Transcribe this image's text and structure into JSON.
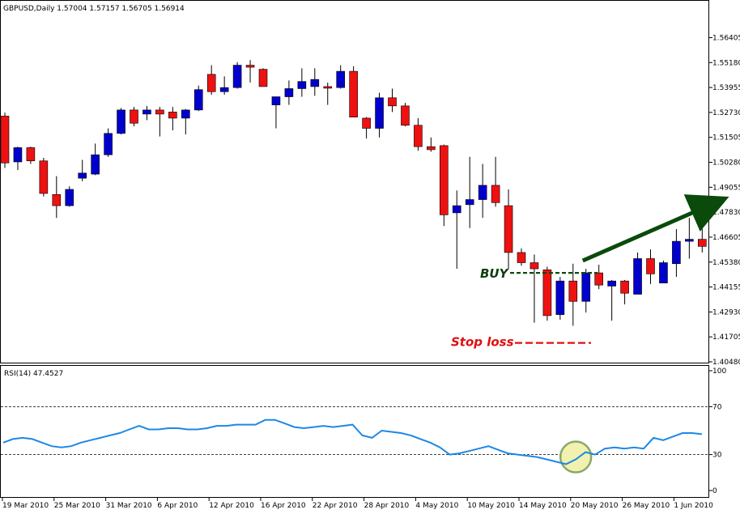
{
  "main_header": "GBPUSD,Daily  1.57004 1.57157 1.56705 1.56914",
  "rsi_header": "RSI(14) 47.4527",
  "chart_data": [
    {
      "type": "candlestick",
      "symbol": "GBPUSD",
      "timeframe": "Daily",
      "ohlc_readout": [
        1.57004,
        1.57157,
        1.56705,
        1.56914
      ],
      "y_ticks": [
        "1.56405",
        "1.55180",
        "1.53955",
        "1.52730",
        "1.51505",
        "1.50280",
        "1.49055",
        "1.47830",
        "1.46605",
        "1.45380",
        "1.44155",
        "1.42930",
        "1.41705",
        "1.40480"
      ],
      "ylim": [
        1.4048,
        1.5702
      ],
      "x_ticks": [
        "19 Mar 2010",
        "25 Mar 2010",
        "31 Mar 2010",
        "6 Apr 2010",
        "12 Apr 2010",
        "16 Apr 2010",
        "22 Apr 2010",
        "28 Apr 2010",
        "4 May 2010",
        "10 May 2010",
        "14 May 2010",
        "20 May 2010",
        "26 May 2010",
        "1 Jun 2010"
      ],
      "x_tick_index": [
        0,
        4,
        8,
        12,
        16,
        20,
        24,
        28,
        32,
        36,
        40,
        44,
        48,
        52
      ],
      "bull_color": "#0000cc",
      "bear_color": "#ee1111",
      "candles": [
        [
          1.5255,
          1.5272,
          1.5,
          1.5025
        ],
        [
          1.503,
          1.5105,
          1.499,
          1.51
        ],
        [
          1.51,
          1.5105,
          1.502,
          1.5035
        ],
        [
          1.5035,
          1.505,
          1.486,
          1.4875
        ],
        [
          1.487,
          1.496,
          1.4755,
          1.4815
        ],
        [
          1.4815,
          1.491,
          1.481,
          1.4895
        ],
        [
          1.495,
          1.504,
          1.4935,
          1.4975
        ],
        [
          1.497,
          1.512,
          1.4965,
          1.5065
        ],
        [
          1.5065,
          1.5195,
          1.5055,
          1.517
        ],
        [
          1.517,
          1.5295,
          1.5165,
          1.5285
        ],
        [
          1.5285,
          1.53,
          1.5205,
          1.522
        ],
        [
          1.5265,
          1.5305,
          1.5235,
          1.5285
        ],
        [
          1.5285,
          1.53,
          1.5155,
          1.5265
        ],
        [
          1.5275,
          1.53,
          1.5185,
          1.5245
        ],
        [
          1.5245,
          1.529,
          1.5165,
          1.5285
        ],
        [
          1.5285,
          1.5405,
          1.528,
          1.5385
        ],
        [
          1.546,
          1.5505,
          1.536,
          1.5375
        ],
        [
          1.5375,
          1.545,
          1.536,
          1.5395
        ],
        [
          1.5395,
          1.552,
          1.539,
          1.5505
        ],
        [
          1.5505,
          1.553,
          1.542,
          1.5495
        ],
        [
          1.5485,
          1.549,
          1.54,
          1.54
        ],
        [
          1.531,
          1.535,
          1.5195,
          1.535
        ],
        [
          1.535,
          1.543,
          1.531,
          1.539
        ],
        [
          1.539,
          1.549,
          1.535,
          1.5425
        ],
        [
          1.54,
          1.549,
          1.5355,
          1.5435
        ],
        [
          1.54,
          1.542,
          1.531,
          1.5395
        ],
        [
          1.5395,
          1.5505,
          1.539,
          1.5475
        ],
        [
          1.5475,
          1.55,
          1.525,
          1.525
        ],
        [
          1.5245,
          1.525,
          1.5145,
          1.5195
        ],
        [
          1.5195,
          1.537,
          1.515,
          1.5345
        ],
        [
          1.5345,
          1.539,
          1.5275,
          1.5305
        ],
        [
          1.5305,
          1.532,
          1.5205,
          1.521
        ],
        [
          1.521,
          1.5245,
          1.5085,
          1.5105
        ],
        [
          1.5105,
          1.515,
          1.508,
          1.509
        ],
        [
          1.511,
          1.5115,
          1.4715,
          1.477
        ],
        [
          1.478,
          1.489,
          1.4505,
          1.4815
        ],
        [
          1.482,
          1.5055,
          1.4705,
          1.4845
        ],
        [
          1.4845,
          1.502,
          1.4755,
          1.4915
        ],
        [
          1.4915,
          1.5055,
          1.481,
          1.483
        ],
        [
          1.4815,
          1.4895,
          1.4505,
          1.4585
        ],
        [
          1.4585,
          1.4605,
          1.452,
          1.4535
        ],
        [
          1.4535,
          1.4575,
          1.424,
          1.4505
        ],
        [
          1.45,
          1.4515,
          1.425,
          1.4275
        ],
        [
          1.428,
          1.4465,
          1.4255,
          1.4445
        ],
        [
          1.4445,
          1.453,
          1.4225,
          1.4345
        ],
        [
          1.4345,
          1.4505,
          1.429,
          1.4485
        ],
        [
          1.4485,
          1.4525,
          1.4405,
          1.4425
        ],
        [
          1.442,
          1.445,
          1.425,
          1.4445
        ],
        [
          1.4445,
          1.445,
          1.433,
          1.4385
        ],
        [
          1.438,
          1.4585,
          1.438,
          1.4555
        ],
        [
          1.4555,
          1.46,
          1.443,
          1.448
        ],
        [
          1.4435,
          1.4545,
          1.4435,
          1.4535
        ],
        [
          1.453,
          1.47,
          1.4465,
          1.464
        ],
        [
          1.464,
          1.4755,
          1.4555,
          1.465
        ],
        [
          1.465,
          1.4725,
          1.4585,
          1.4615
        ]
      ],
      "annotations": {
        "buy_label": "BUY",
        "buy_level": 1.4485,
        "stop_label": "Stop loss",
        "stop_level": 1.4145,
        "arrow_from": [
          44,
          1.4545
        ],
        "arrow_to": [
          57,
          1.4835
        ],
        "arrow_color": "#0a4a0a"
      }
    },
    {
      "type": "line",
      "name": "RSI(14)",
      "value": 47.4527,
      "y_ticks": [
        "100",
        "70",
        "30",
        "0"
      ],
      "ylim": [
        0,
        100
      ],
      "levels": [
        70,
        30
      ],
      "color": "#1e88e5",
      "values": [
        40,
        43,
        44,
        43,
        40,
        37,
        36,
        37,
        40,
        42,
        44,
        46,
        48,
        51,
        54,
        51,
        51,
        52,
        52,
        51,
        51,
        52,
        54,
        54,
        55,
        55,
        55,
        59,
        59,
        56,
        53,
        52,
        53,
        54,
        53,
        54,
        55,
        46,
        44,
        50,
        49,
        48,
        46,
        43,
        40,
        36,
        30,
        31,
        33,
        35,
        37,
        34,
        31,
        30,
        29,
        28,
        26,
        24,
        22,
        26,
        32,
        30,
        35,
        36,
        35,
        36,
        35,
        44,
        42,
        45,
        48,
        48,
        47
      ],
      "highlight_index": 59,
      "highlight_value": 28,
      "highlight_color": "#f1f1b0"
    }
  ]
}
